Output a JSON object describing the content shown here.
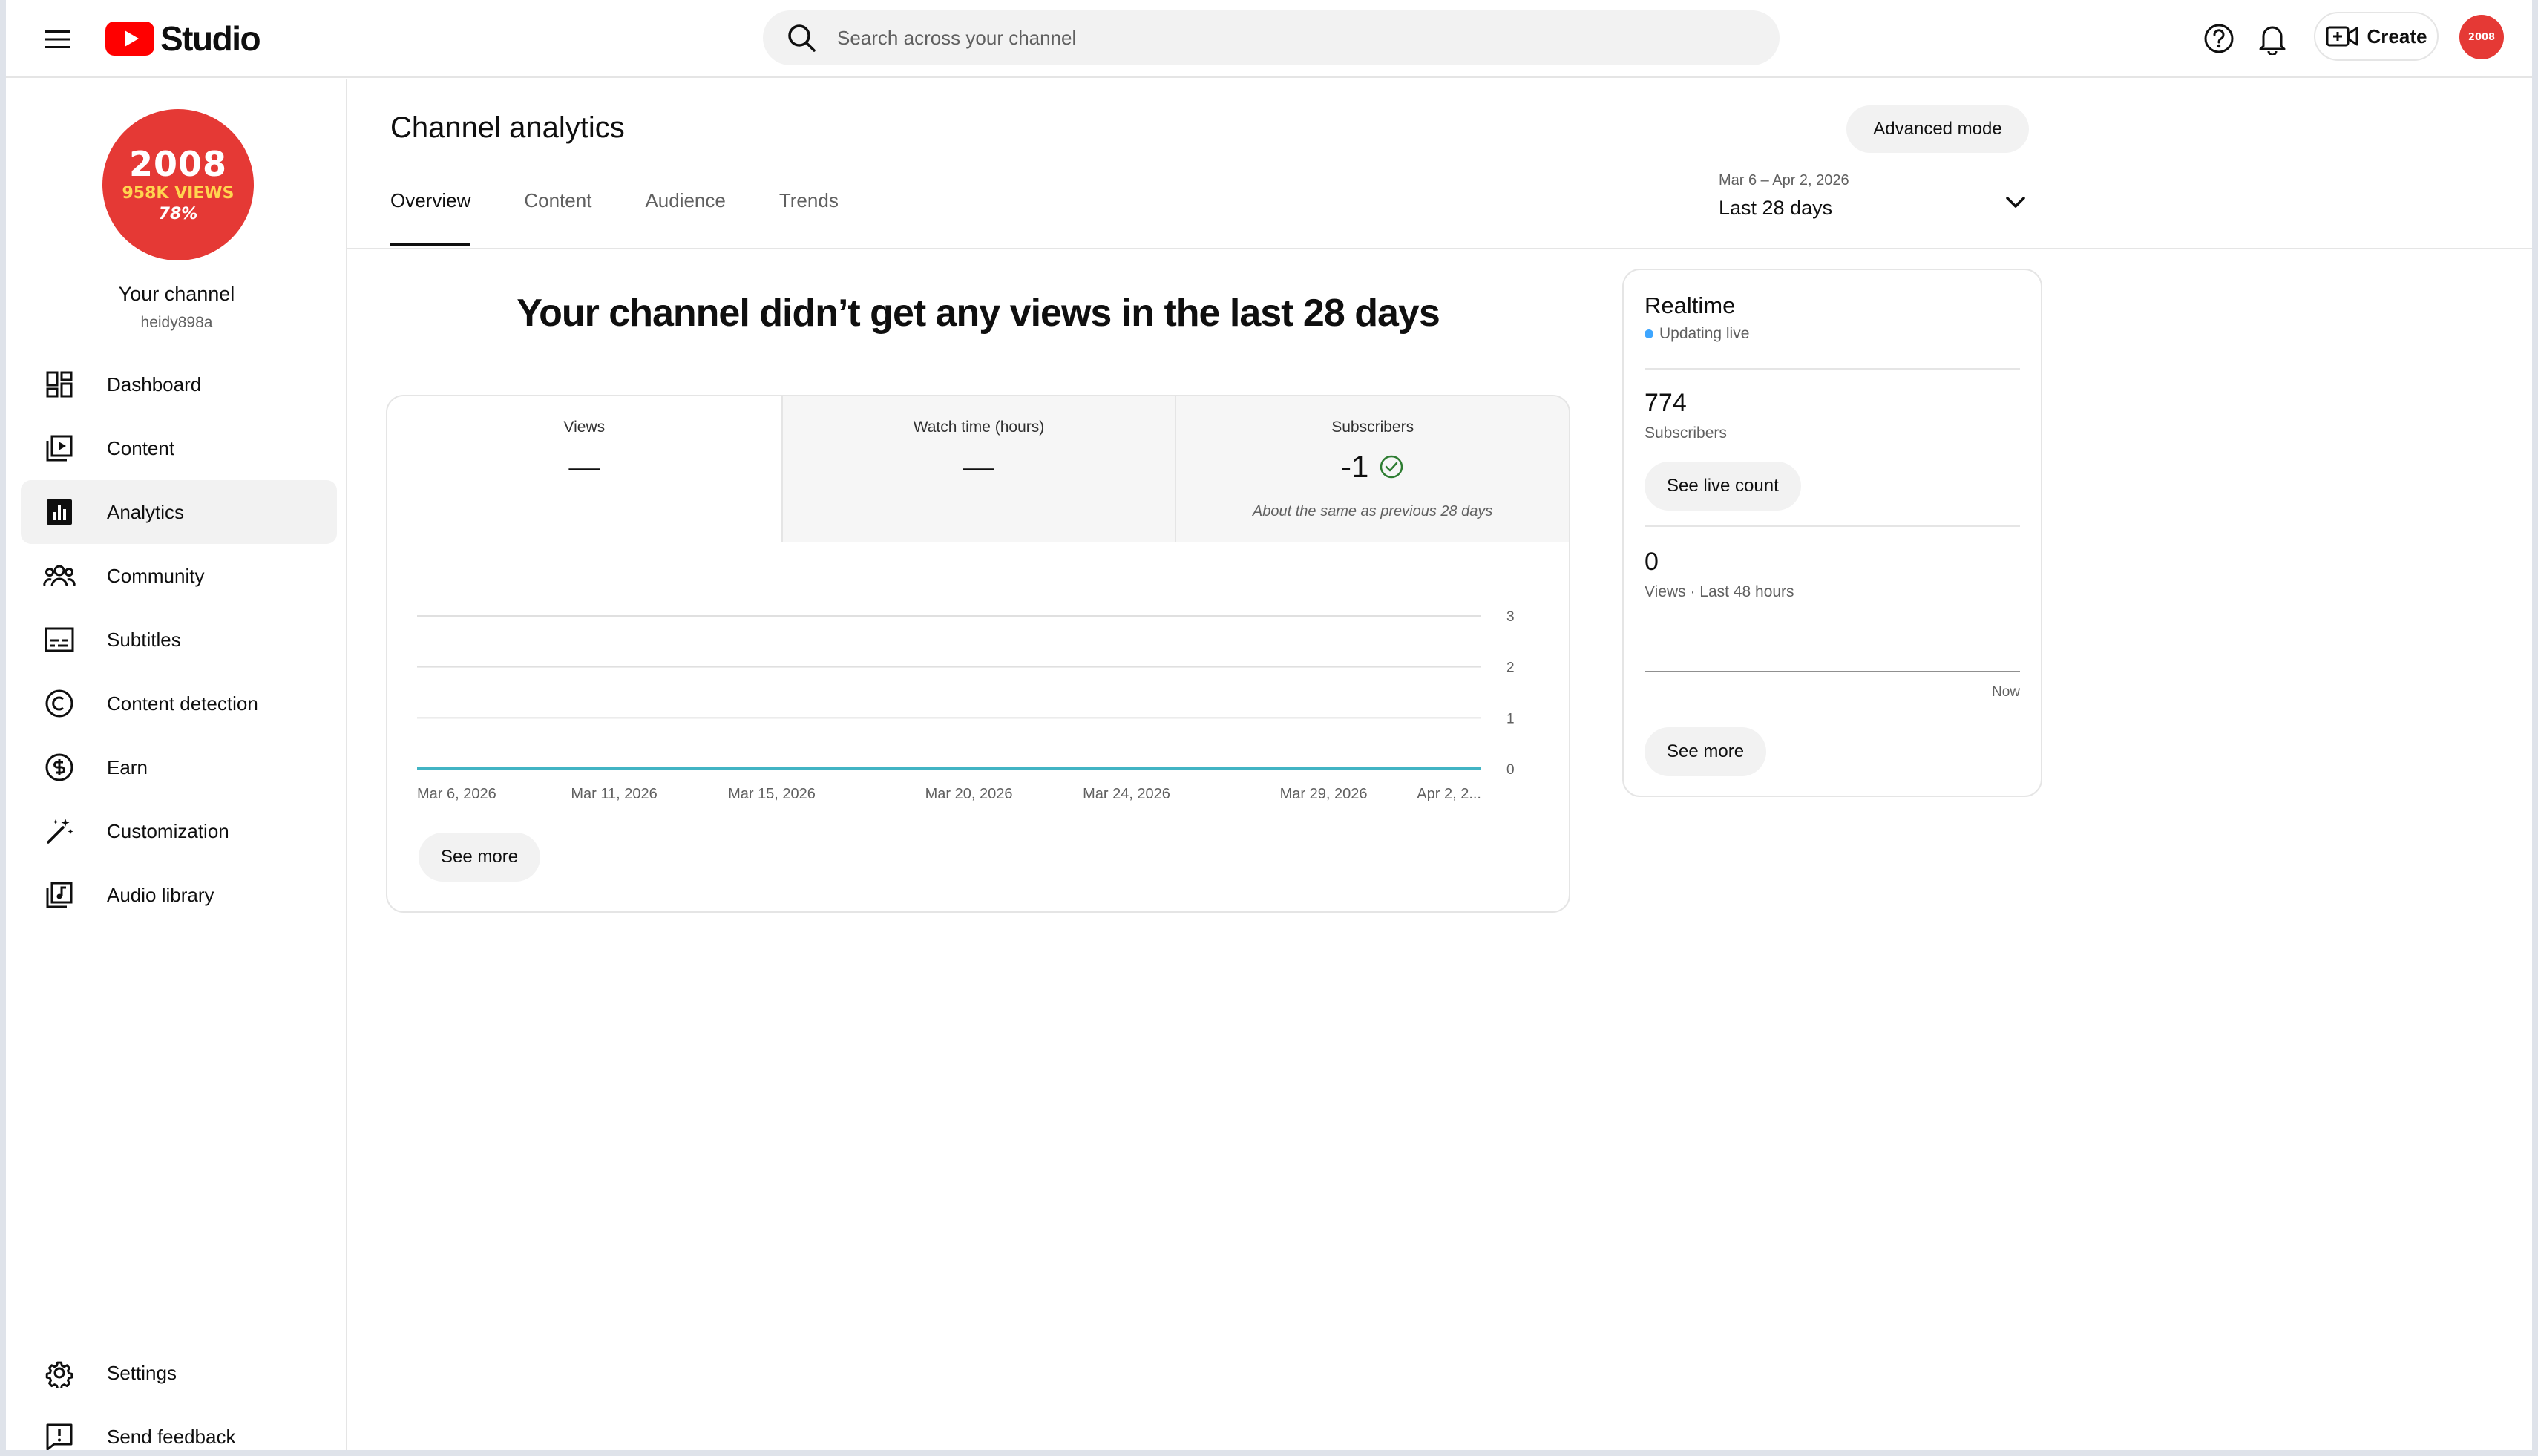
{
  "header": {
    "logo_text": "Studio",
    "search_placeholder": "Search across your channel",
    "create_label": "Create"
  },
  "sidebar": {
    "channel_name": "Your channel",
    "channel_handle": "heidy898a",
    "avatar": {
      "year": "2008",
      "views": "958K VIEWS",
      "pct": "78%"
    },
    "items": [
      {
        "label": "Dashboard",
        "icon": "dashboard-icon"
      },
      {
        "label": "Content",
        "icon": "content-icon"
      },
      {
        "label": "Analytics",
        "icon": "analytics-icon",
        "active": true
      },
      {
        "label": "Community",
        "icon": "community-icon"
      },
      {
        "label": "Subtitles",
        "icon": "subtitles-icon"
      },
      {
        "label": "Content detection",
        "icon": "copyright-icon"
      },
      {
        "label": "Earn",
        "icon": "dollar-icon"
      },
      {
        "label": "Customization",
        "icon": "magic-wand-icon"
      },
      {
        "label": "Audio library",
        "icon": "audio-library-icon"
      }
    ],
    "bottom_items": [
      {
        "label": "Settings",
        "icon": "gear-icon"
      },
      {
        "label": "Send feedback",
        "icon": "feedback-icon"
      }
    ]
  },
  "main": {
    "title": "Channel analytics",
    "advanced_mode_label": "Advanced mode",
    "tabs": [
      {
        "label": "Overview",
        "active": true
      },
      {
        "label": "Content"
      },
      {
        "label": "Audience"
      },
      {
        "label": "Trends"
      }
    ],
    "date_range": {
      "sub": "Mar 6 – Apr 2, 2026",
      "main": "Last 28 days"
    },
    "headline": "Your channel didn’t get any views in the last 28 days",
    "metrics": [
      {
        "label": "Views",
        "value": "—"
      },
      {
        "label": "Watch time (hours)",
        "value": "—"
      },
      {
        "label": "Subscribers",
        "value": "-1",
        "note": "About the same as previous 28 days"
      }
    ],
    "see_more_label": "See more"
  },
  "chart_data": {
    "type": "line",
    "x": [
      "Mar 6, 2026",
      "Mar 11, 2026",
      "Mar 15, 2026",
      "Mar 20, 2026",
      "Mar 24, 2026",
      "Mar 29, 2026",
      "Apr 2, 2..."
    ],
    "series": [
      {
        "values": [
          0,
          0,
          0,
          0,
          0,
          0,
          0
        ]
      }
    ],
    "yticks": [
      "0",
      "1",
      "2",
      "3"
    ],
    "ylim": [
      0,
      3
    ],
    "grid": true,
    "line_color": "#41b4c4"
  },
  "realtime": {
    "title": "Realtime",
    "live_label": "Updating live",
    "subscribers_value": "774",
    "subscribers_label": "Subscribers",
    "see_live_label": "See live count",
    "views_value": "0",
    "views_label": "Views · Last 48 hours",
    "now_label": "Now",
    "see_more_label": "See more"
  },
  "colors": {
    "accent_red": "#ff0000",
    "avatar_red": "#e53935",
    "live_blue": "#3ea6ff",
    "check_green": "#2e7d32"
  }
}
